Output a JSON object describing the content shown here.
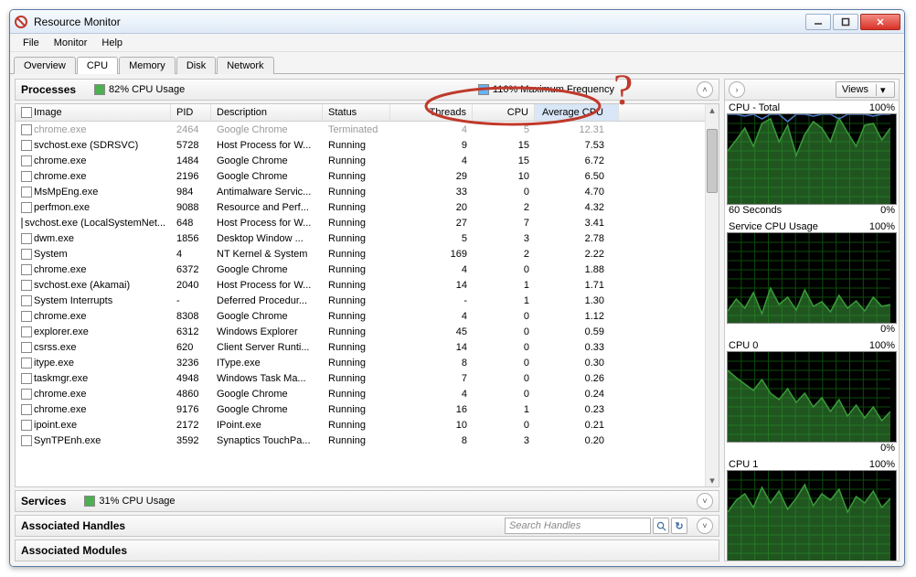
{
  "window_title": "Resource Monitor",
  "menu": [
    "File",
    "Monitor",
    "Help"
  ],
  "tabs": [
    "Overview",
    "CPU",
    "Memory",
    "Disk",
    "Network"
  ],
  "active_tab": "CPU",
  "processes_section": {
    "title": "Processes",
    "cpu_usage": "82% CPU Usage",
    "max_freq": "110% Maximum Frequency"
  },
  "columns": {
    "image": "Image",
    "pid": "PID",
    "desc": "Description",
    "status": "Status",
    "threads": "Threads",
    "cpu": "CPU",
    "avg": "Average CPU"
  },
  "rows": [
    {
      "img": "chrome.exe",
      "pid": "2464",
      "desc": "Google Chrome",
      "stat": "Terminated",
      "thr": "4",
      "cpu": "5",
      "avg": "12.31",
      "dim": true
    },
    {
      "img": "svchost.exe (SDRSVC)",
      "pid": "5728",
      "desc": "Host Process for W...",
      "stat": "Running",
      "thr": "9",
      "cpu": "15",
      "avg": "7.53"
    },
    {
      "img": "chrome.exe",
      "pid": "1484",
      "desc": "Google Chrome",
      "stat": "Running",
      "thr": "4",
      "cpu": "15",
      "avg": "6.72"
    },
    {
      "img": "chrome.exe",
      "pid": "2196",
      "desc": "Google Chrome",
      "stat": "Running",
      "thr": "29",
      "cpu": "10",
      "avg": "6.50"
    },
    {
      "img": "MsMpEng.exe",
      "pid": "984",
      "desc": "Antimalware Servic...",
      "stat": "Running",
      "thr": "33",
      "cpu": "0",
      "avg": "4.70"
    },
    {
      "img": "perfmon.exe",
      "pid": "9088",
      "desc": "Resource and Perf...",
      "stat": "Running",
      "thr": "20",
      "cpu": "2",
      "avg": "4.32"
    },
    {
      "img": "svchost.exe (LocalSystemNet...",
      "pid": "648",
      "desc": "Host Process for W...",
      "stat": "Running",
      "thr": "27",
      "cpu": "7",
      "avg": "3.41"
    },
    {
      "img": "dwm.exe",
      "pid": "1856",
      "desc": "Desktop Window ...",
      "stat": "Running",
      "thr": "5",
      "cpu": "3",
      "avg": "2.78"
    },
    {
      "img": "System",
      "pid": "4",
      "desc": "NT Kernel & System",
      "stat": "Running",
      "thr": "169",
      "cpu": "2",
      "avg": "2.22"
    },
    {
      "img": "chrome.exe",
      "pid": "6372",
      "desc": "Google Chrome",
      "stat": "Running",
      "thr": "4",
      "cpu": "0",
      "avg": "1.88"
    },
    {
      "img": "svchost.exe (Akamai)",
      "pid": "2040",
      "desc": "Host Process for W...",
      "stat": "Running",
      "thr": "14",
      "cpu": "1",
      "avg": "1.71"
    },
    {
      "img": "System Interrupts",
      "pid": "-",
      "desc": "Deferred Procedur...",
      "stat": "Running",
      "thr": "-",
      "cpu": "1",
      "avg": "1.30"
    },
    {
      "img": "chrome.exe",
      "pid": "8308",
      "desc": "Google Chrome",
      "stat": "Running",
      "thr": "4",
      "cpu": "0",
      "avg": "1.12"
    },
    {
      "img": "explorer.exe",
      "pid": "6312",
      "desc": "Windows Explorer",
      "stat": "Running",
      "thr": "45",
      "cpu": "0",
      "avg": "0.59"
    },
    {
      "img": "csrss.exe",
      "pid": "620",
      "desc": "Client Server Runti...",
      "stat": "Running",
      "thr": "14",
      "cpu": "0",
      "avg": "0.33"
    },
    {
      "img": "itype.exe",
      "pid": "3236",
      "desc": "IType.exe",
      "stat": "Running",
      "thr": "8",
      "cpu": "0",
      "avg": "0.30"
    },
    {
      "img": "taskmgr.exe",
      "pid": "4948",
      "desc": "Windows Task Ma...",
      "stat": "Running",
      "thr": "7",
      "cpu": "0",
      "avg": "0.26"
    },
    {
      "img": "chrome.exe",
      "pid": "4860",
      "desc": "Google Chrome",
      "stat": "Running",
      "thr": "4",
      "cpu": "0",
      "avg": "0.24"
    },
    {
      "img": "chrome.exe",
      "pid": "9176",
      "desc": "Google Chrome",
      "stat": "Running",
      "thr": "16",
      "cpu": "1",
      "avg": "0.23"
    },
    {
      "img": "ipoint.exe",
      "pid": "2172",
      "desc": "IPoint.exe",
      "stat": "Running",
      "thr": "10",
      "cpu": "0",
      "avg": "0.21"
    },
    {
      "img": "SynTPEnh.exe",
      "pid": "3592",
      "desc": "Synaptics TouchPa...",
      "stat": "Running",
      "thr": "8",
      "cpu": "3",
      "avg": "0.20"
    }
  ],
  "services": {
    "title": "Services",
    "cpu": "31% CPU Usage"
  },
  "assoc_handles": {
    "title": "Associated Handles",
    "search_placeholder": "Search Handles"
  },
  "assoc_modules": {
    "title": "Associated Modules"
  },
  "right_panel": {
    "views": "Views",
    "charts": [
      {
        "title": "CPU - Total",
        "right": "100%",
        "foot_left": "60 Seconds",
        "foot_right": "0%"
      },
      {
        "title": "Service CPU Usage",
        "right": "100%",
        "foot_left": "",
        "foot_right": "0%"
      },
      {
        "title": "CPU 0",
        "right": "100%",
        "foot_left": "",
        "foot_right": "0%"
      },
      {
        "title": "CPU 1",
        "right": "100%",
        "foot_left": "",
        "foot_right": ""
      }
    ]
  },
  "chart_data": [
    {
      "type": "area",
      "title": "CPU - Total",
      "ylim": [
        0,
        100
      ],
      "series": [
        {
          "name": "total",
          "color": "#3a9a3a",
          "values": [
            60,
            72,
            85,
            65,
            90,
            95,
            70,
            88,
            55,
            78,
            92,
            85,
            70,
            96,
            80,
            65,
            88,
            90,
            72,
            85
          ]
        },
        {
          "name": "freq",
          "color": "#4a7ac8",
          "values": [
            100,
            100,
            98,
            100,
            95,
            100,
            100,
            92,
            100,
            100,
            98,
            100,
            100,
            95,
            100,
            100,
            100,
            98,
            100,
            100
          ]
        }
      ]
    },
    {
      "type": "area",
      "title": "Service CPU Usage",
      "ylim": [
        0,
        100
      ],
      "series": [
        {
          "name": "svc",
          "color": "#3a9a3a",
          "values": [
            15,
            28,
            18,
            35,
            12,
            40,
            22,
            30,
            16,
            38,
            20,
            25,
            14,
            32,
            18,
            26,
            15,
            30,
            20,
            22
          ]
        }
      ]
    },
    {
      "type": "area",
      "title": "CPU 0",
      "ylim": [
        0,
        100
      ],
      "series": [
        {
          "name": "cpu0",
          "color": "#3a9a3a",
          "values": [
            80,
            72,
            65,
            58,
            70,
            55,
            48,
            60,
            45,
            55,
            40,
            50,
            35,
            48,
            30,
            42,
            28,
            40,
            25,
            35
          ]
        }
      ]
    },
    {
      "type": "area",
      "title": "CPU 1",
      "ylim": [
        0,
        100
      ],
      "series": [
        {
          "name": "cpu1",
          "color": "#3a9a3a",
          "values": [
            55,
            68,
            75,
            60,
            82,
            65,
            78,
            58,
            70,
            85,
            62,
            75,
            68,
            80,
            55,
            72,
            65,
            78,
            60,
            70
          ]
        }
      ]
    }
  ]
}
